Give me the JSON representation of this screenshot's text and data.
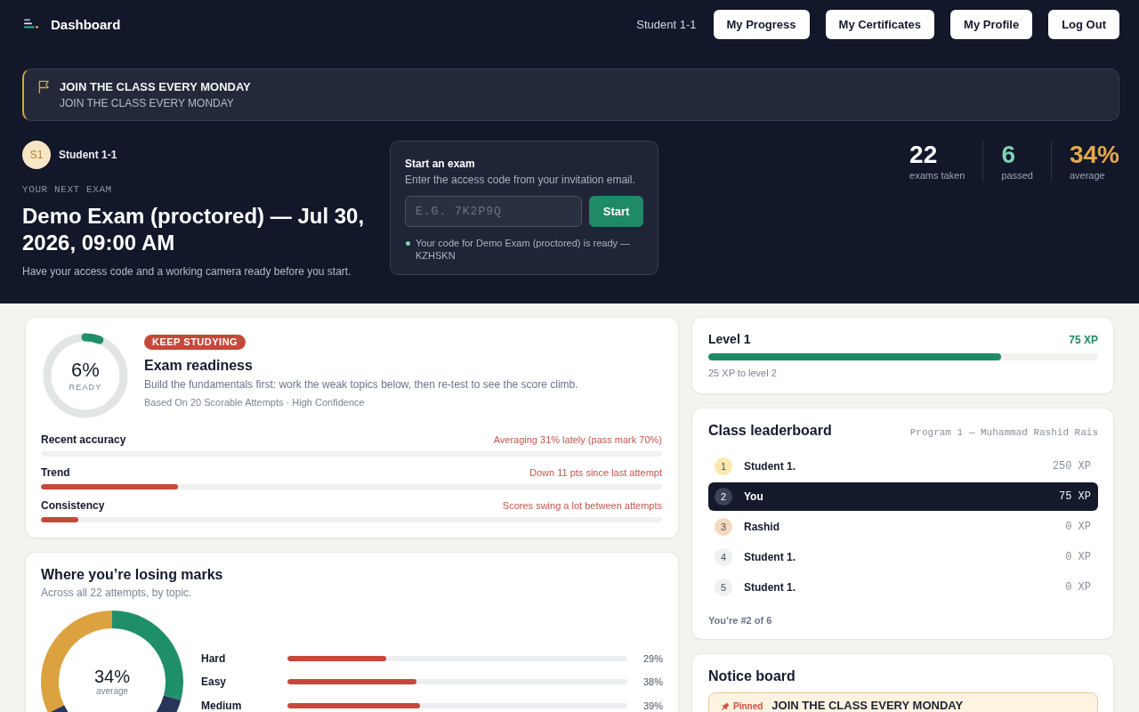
{
  "header": {
    "title": "Dashboard",
    "user": "Student 1-1",
    "buttons": [
      "My Progress",
      "My Certificates",
      "My Profile",
      "Log Out"
    ]
  },
  "announcement": {
    "title": "JOIN THE CLASS EVERY MONDAY",
    "text": "JOIN THE CLASS EVERY MONDAY"
  },
  "student": {
    "initials": "S1",
    "name": "Student 1-1"
  },
  "next_exam": {
    "label": "YOUR NEXT EXAM",
    "title": "Demo Exam (proctored) — Jul 30, 2026, 09:00 AM",
    "note": "Have your access code and a working camera ready before you start."
  },
  "start_exam": {
    "title": "Start an exam",
    "description": "Enter the access code from your invitation email.",
    "placeholder": "E.G. 7K2P9Q",
    "button": "Start",
    "status": "Your code for Demo Exam (proctored) is ready — KZHSKN"
  },
  "stats": [
    {
      "value": "22",
      "label": "exams taken",
      "color": "#ffffff"
    },
    {
      "value": "6",
      "label": "passed",
      "color": "#7fd0b5"
    },
    {
      "value": "34%",
      "label": "average",
      "color": "#e3a94b"
    }
  ],
  "readiness": {
    "level": 0.06,
    "percent": "6%",
    "caption": "READY",
    "badge": "KEEP STUDYING",
    "title": "Exam readiness",
    "description": "Build the fundamentals first: work the weak topics below, then re-test to see the score climb.",
    "meta": "Based On 20 Scorable Attempts · High Confidence",
    "metrics": [
      {
        "label": "Recent accuracy",
        "note": "Averaging 31% lately (pass mark 70%)"
      },
      {
        "label": "Trend",
        "note": "Down 11 pts since last attempt",
        "level": 0.22
      },
      {
        "label": "Consistency",
        "note": "Scores swing a lot between attempts",
        "level": 0.06
      }
    ]
  },
  "losing_marks": {
    "title": "Where you’re losing marks",
    "subtitle": "Across all 22 attempts, by topic.",
    "donut_value": "34%",
    "donut_caption": "average",
    "topics": [
      {
        "label": "Hard",
        "level": 0.29,
        "value": "29%"
      },
      {
        "label": "Easy",
        "level": 0.38,
        "value": "38%"
      },
      {
        "label": "Medium",
        "level": 0.39,
        "value": "39%"
      }
    ]
  },
  "xp_level": {
    "title": "Level 1",
    "xp": "75 XP",
    "level": 0.75,
    "note": "25 XP to level 2"
  },
  "leaderboard": {
    "title": "Class leaderboard",
    "subtitle": "Program 1 — Muhammad Rashid Rais",
    "rows": [
      {
        "rank": "1",
        "name": "Student 1.",
        "xp": "250 XP",
        "selected": false,
        "color": "#fbe8ae"
      },
      {
        "rank": "2",
        "name": "You",
        "xp": "75 XP",
        "selected": true,
        "color": "#3d4358"
      },
      {
        "rank": "3",
        "name": "Rashid",
        "xp": "0 XP",
        "selected": false,
        "color": "#f5d9bf"
      },
      {
        "rank": "4",
        "name": "Student 1.",
        "xp": "0 XP",
        "selected": false,
        "color": "#eef0f3"
      },
      {
        "rank": "5",
        "name": "Student 1.",
        "xp": "0 XP",
        "selected": false,
        "color": "#eef0f3"
      }
    ],
    "footer": "You’re #2 of 6"
  },
  "notice_board": {
    "title": "Notice board",
    "notices": [
      {
        "pinned": true,
        "tag": "Pinned",
        "title": "JOIN THE CLASS EVERY MONDAY"
      }
    ]
  }
}
